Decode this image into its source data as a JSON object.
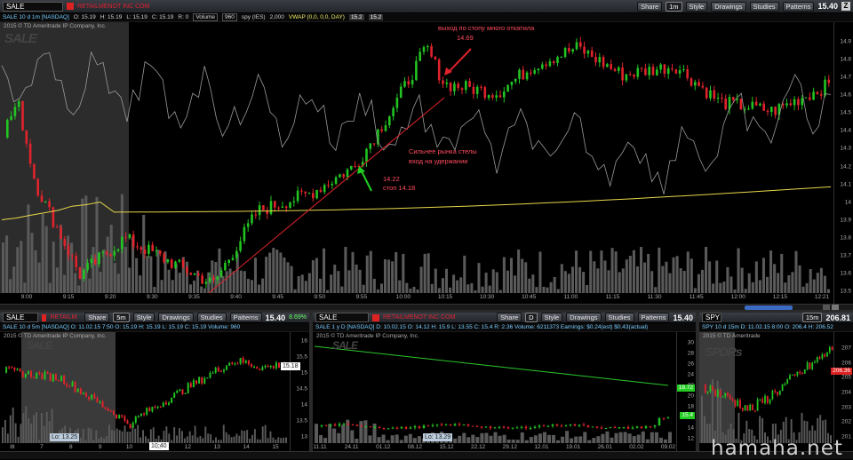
{
  "main": {
    "symbol": "SALE",
    "company": "RETAILMENOT INC COM",
    "buttons": [
      "Share",
      "1m",
      "Style",
      "Drawings",
      "Studies",
      "Patterns"
    ],
    "last_price": "15.40",
    "info": {
      "title": "SALE 10 d 1m [NASDAQ]",
      "o": "O: 15.19",
      "h": "H: 15.19",
      "l": "L: 15.19",
      "c": "C: 15.19",
      "r": "R: 0",
      "volume": "Volume",
      "volume_val": "960",
      "spy": "spy (IES)",
      "spy_val": "2,000",
      "vwap": "VWAP (0,0, 0,0, DAY)",
      "vwap_a": "15.2",
      "vwap_b": "15.2"
    },
    "copyright": "2015 © TD Ameritrade IP Company, Inc.",
    "watermark": "SALE",
    "y_ticks": [
      "14.9",
      "14.8",
      "14.7",
      "14.6",
      "14.5",
      "14.4",
      "14.3",
      "14.2",
      "14.1",
      "14",
      "13.9",
      "13.8",
      "13.7",
      "13.6",
      "13.5"
    ],
    "x_ticks": [
      "9:00",
      "9:15",
      "9:20",
      "9:30",
      "9:35",
      "9:40",
      "9:45",
      "9:50",
      "9:55",
      "10:00",
      "10:15",
      "10:30",
      "10:45",
      "11:00",
      "11:15",
      "11:30",
      "11:45",
      "12:00",
      "12:15",
      "12:21"
    ],
    "annotations": {
      "exit_text": "выход по стопу много откатила",
      "exit_price": "14.69",
      "entry_text_1": "Сильнее рынка стелы",
      "entry_text_2": "вход на удержании",
      "entry_price": "14.22",
      "stop": "стоп 14.18"
    }
  },
  "bottom_left": {
    "symbol": "SALE",
    "company": "RETAILMENOT",
    "buttons": [
      "Share",
      "5m",
      "Style",
      "Drawings",
      "Studies",
      "Patterns"
    ],
    "last_price": "15.40",
    "change": "8.69%",
    "info": "SALE 10 d 5m [NASDAQ]   O: 11.02.15 7:50   O: 15.19   H: 15.19   L: 15.19   C: 15.19   Volume: 960",
    "copyright": "2015 © TD Ameritrade IP Company, Inc.",
    "watermark": "SALE",
    "y_ticks": [
      "16",
      "15.5",
      "15",
      "14.5",
      "14",
      "13.5",
      "13"
    ],
    "x_ticks": [
      "8t",
      "7",
      "8",
      "9",
      "10",
      "11",
      "12",
      "13",
      "14",
      "15"
    ],
    "price_tag": "15.18",
    "lo_tag": "Lo: 13.25",
    "time_tag": "10:40"
  },
  "bottom_mid": {
    "symbol": "SALE",
    "company": "RETAILMENOT INC COM",
    "buttons": [
      "Share",
      "D",
      "Style",
      "Drawings",
      "Studies",
      "Patterns"
    ],
    "last_price": "15.40",
    "info": "SALE 1 y D [NASDAQ]   D: 10.02.15   O: 14.12   H: 15.9   L: 13.55   C: 15.4   R: 2.36   Volume: 6211373   Earnings: $0.24(est) $0.43(actual)",
    "copyright": "2015 © TD Ameritrade IP Company, Inc.",
    "watermark": "SALE",
    "y_ticks": [
      "30",
      "28",
      "26",
      "24",
      "22",
      "20",
      "18",
      "16",
      "14",
      "12"
    ],
    "x_ticks": [
      "11.11",
      "24.11",
      "01.12",
      "08.12",
      "15.12",
      "22.12",
      "29.12",
      "12.01",
      "19.01",
      "26.01",
      "02.02",
      "09.02"
    ],
    "price_tag": "15.4",
    "green_tag": "18.72",
    "lo_tag": "Lo: 13.29"
  },
  "bottom_right": {
    "symbol": "SPY",
    "buttons": [
      "15m"
    ],
    "last_price": "206.81",
    "info": "SPY 10 d 15m   D: 11.02.15 8:00   O: 206.4   H: 206.52",
    "copyright": "2015 © TD Ameritrade",
    "watermark": "SPDRs",
    "y_ticks": [
      "207",
      "206",
      "205",
      "204",
      "203",
      "202",
      "201"
    ],
    "price_tag": "206.36"
  },
  "site": "hamaha.net",
  "colors": {
    "up": "#22c322",
    "down": "#e0232b",
    "vwap": "#e8d84a",
    "accent": "#3b6bc4"
  }
}
